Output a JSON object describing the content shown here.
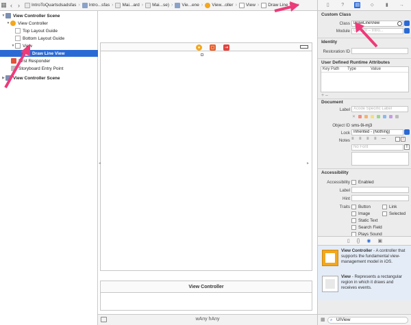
{
  "jumpbar": {
    "crumbs": [
      "IntroToQuartsdsadsfas",
      "Intro...sfas",
      "Mai...ard",
      "Mai...se)",
      "Vie...ene",
      "View...oller",
      "View",
      "Draw Line View"
    ]
  },
  "outline": {
    "scene1": "View Controller Scene",
    "vc": "View Controller",
    "top_guide": "Top Layout Guide",
    "bottom_guide": "Bottom Layout Guide",
    "view": "View",
    "draw_line_view": "Draw Line View",
    "first_responder": "First Responder",
    "entry_point": "Storyboard Entry Point",
    "scene2": "View Controller Scene"
  },
  "canvas": {
    "vc_label": "View Controller",
    "size_class": "wAny hAny"
  },
  "inspector": {
    "custom_class_title": "Custom Class",
    "class_label": "Class",
    "class_value": "DrawLineView",
    "module_label": "Module",
    "module_placeholder": "Current – Intro...",
    "identity_title": "Identity",
    "restoration_label": "Restoration ID",
    "runtime_title": "User Defined Runtime Attributes",
    "col_keypath": "Key Path",
    "col_type": "Type",
    "col_value": "Value",
    "add_remove": "+  –",
    "document_title": "Document",
    "doc_label_label": "Label",
    "doc_label_placeholder": "Xcode Specific Label",
    "object_id_label": "Object ID",
    "object_id_value": "sms-9i-mj3",
    "lock_label": "Lock",
    "lock_value": "Inherited - (Nothing)",
    "notes_label": "Notes",
    "no_font": "No Font",
    "accessibility_title": "Accessibility",
    "accessibility_label": "Accessibility",
    "enabled": "Enabled",
    "acc_label_label": "Label",
    "hint_label": "Hint",
    "traits_label": "Traits",
    "traits": [
      "Button",
      "Link",
      "Image",
      "Selected",
      "Static Text",
      "Search Field",
      "Plays Sound"
    ]
  },
  "library": {
    "items": [
      {
        "title": "View Controller",
        "desc": " - A controller that supports the fundamental view-management model in iOS."
      },
      {
        "title": "View",
        "desc": " - Represents a rectangular region in which it draws and receives events."
      }
    ],
    "filter_value": "UIView"
  },
  "colors": {
    "selection": "#2a6ad5",
    "arrow": "#ee3a79",
    "vc_icon": "#f3a71c"
  }
}
